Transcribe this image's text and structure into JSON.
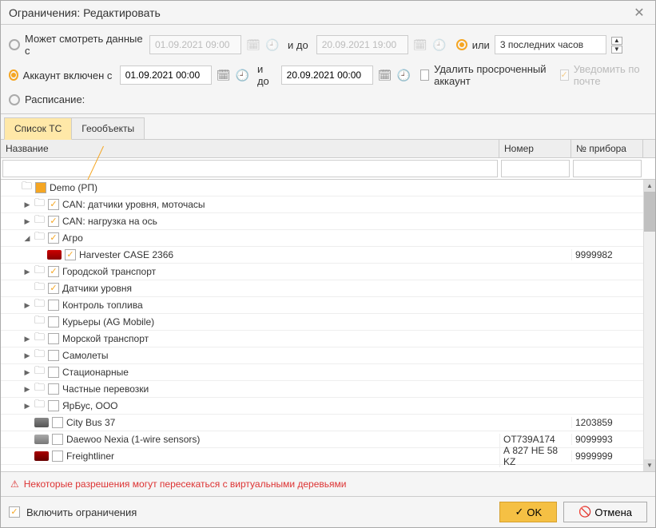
{
  "title": "Ограничения: Редактировать",
  "p1": {
    "canView": "Может смотреть данные с",
    "from": "01.09.2021 09:00",
    "andTo": "и до",
    "to": "20.09.2021 19:00",
    "or": "или",
    "lastHours": "3 последних часов"
  },
  "p2": {
    "acctOn": "Аккаунт включен с",
    "from": "01.09.2021 00:00",
    "andTo": "и до",
    "to": "20.09.2021 00:00",
    "delExpired": "Удалить просроченный аккаунт",
    "notify": "Уведомить по почте",
    "schedule": "Расписание:"
  },
  "tabs": {
    "list": "Список ТС",
    "geo": "Геообъекты"
  },
  "cols": {
    "name": "Название",
    "num": "Номер",
    "dev": "№ прибора"
  },
  "rows": [
    {
      "i": 0,
      "t": "f",
      "exp": "",
      "chk": "partial",
      "label": "Demo (РП)"
    },
    {
      "i": 1,
      "t": "f",
      "exp": "▶",
      "chk": "on",
      "label": "CAN: датчики уровня, моточасы"
    },
    {
      "i": 1,
      "t": "f",
      "exp": "▶",
      "chk": "on",
      "label": "CAN: нагрузка на ось"
    },
    {
      "i": 1,
      "t": "f",
      "exp": "◢",
      "chk": "on",
      "label": "Агро"
    },
    {
      "i": 2,
      "t": "v",
      "veh": "harv",
      "chk": "on",
      "label": "Harvester CASE 2366",
      "dev": "9999982"
    },
    {
      "i": 1,
      "t": "f",
      "exp": "▶",
      "chk": "on",
      "label": "Городской транспорт"
    },
    {
      "i": 1,
      "t": "f",
      "exp": "",
      "chk": "on",
      "label": "Датчики уровня"
    },
    {
      "i": 1,
      "t": "f",
      "exp": "▶",
      "chk": "",
      "label": "Контроль топлива"
    },
    {
      "i": 1,
      "t": "f",
      "exp": "",
      "chk": "",
      "label": "Курьеры (AG Mobile)"
    },
    {
      "i": 1,
      "t": "f",
      "exp": "▶",
      "chk": "",
      "label": "Морской транспорт"
    },
    {
      "i": 1,
      "t": "f",
      "exp": "▶",
      "chk": "",
      "label": "Самолеты"
    },
    {
      "i": 1,
      "t": "f",
      "exp": "▶",
      "chk": "",
      "label": "Стационарные"
    },
    {
      "i": 1,
      "t": "f",
      "exp": "▶",
      "chk": "",
      "label": "Частные перевозки"
    },
    {
      "i": 1,
      "t": "f",
      "exp": "▶",
      "chk": "",
      "label": "ЯрБус, ООО"
    },
    {
      "i": 1,
      "t": "v",
      "veh": "bus",
      "chk": "",
      "label": "City Bus 37",
      "dev": "1203859"
    },
    {
      "i": 1,
      "t": "v",
      "veh": "car",
      "chk": "",
      "label": "Daewoo Nexia (1-wire sensors)",
      "num": "ОТ739А174",
      "dev": "9099993"
    },
    {
      "i": 1,
      "t": "v",
      "veh": "truck",
      "chk": "",
      "label": "Freightliner",
      "num": "А 827 НЕ 58 KZ",
      "dev": "9999999"
    }
  ],
  "warning": "Некоторые разрешения могут пересекаться с виртуальными деревьями",
  "foot": {
    "enable": "Включить ограничения",
    "ok": "OK",
    "cancel": "Отмена"
  }
}
